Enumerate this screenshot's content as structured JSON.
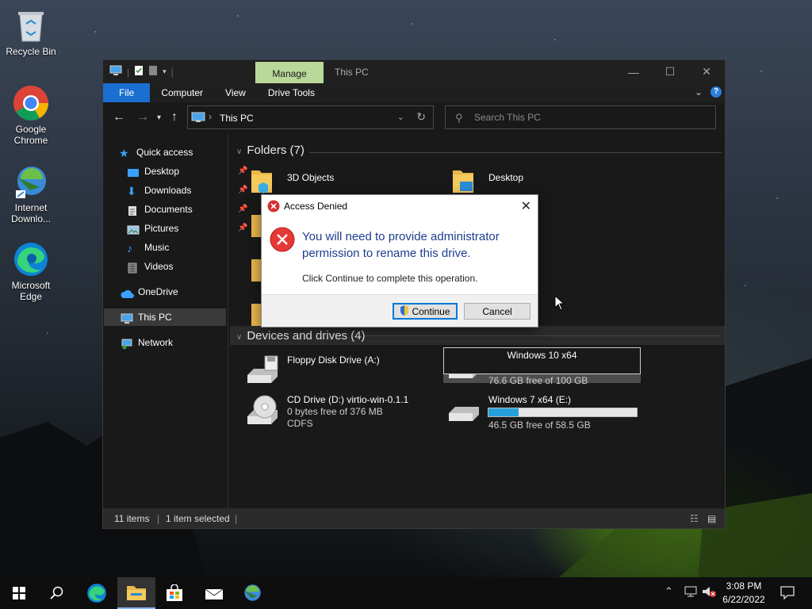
{
  "desktop": {
    "icons": [
      {
        "label": "Recycle Bin"
      },
      {
        "label": "Google Chrome"
      },
      {
        "label": "Internet Downlo..."
      },
      {
        "label": "Microsoft Edge"
      }
    ]
  },
  "explorer": {
    "context_tab": "Manage",
    "title": "This PC",
    "ribbon_tabs": [
      "File",
      "Computer",
      "View",
      "Drive Tools"
    ],
    "address": "This PC",
    "search_placeholder": "Search This PC",
    "nav": {
      "quick_access": "Quick access",
      "items": [
        "Desktop",
        "Downloads",
        "Documents",
        "Pictures",
        "Music",
        "Videos"
      ],
      "onedrive": "OneDrive",
      "this_pc": "This PC",
      "network": "Network"
    },
    "folders_header": "Folders (7)",
    "folders": [
      {
        "name": "3D Objects"
      },
      {
        "name": "Desktop"
      }
    ],
    "devices_header": "Devices and drives (4)",
    "drives": [
      {
        "name": "Floppy Disk Drive (A:)",
        "line2": "",
        "line3": ""
      },
      {
        "name": "Windows 10 x64",
        "line2": "76.6 GB free of 100 GB",
        "used_fraction": 0.234
      },
      {
        "name": "CD Drive (D:) virtio-win-0.1.1",
        "line2": "0 bytes free of 376 MB",
        "line3": "CDFS"
      },
      {
        "name": "Windows 7 x64 (E:)",
        "line2": "46.5 GB free of 58.5 GB",
        "used_fraction": 0.205
      }
    ],
    "status": {
      "items": "11 items",
      "selected": "1 item selected"
    }
  },
  "dialog": {
    "title": "Access Denied",
    "message": "You will need to provide administrator permission to rename this drive.",
    "hint": "Click Continue to complete this operation.",
    "continue_label": "Continue",
    "cancel_label": "Cancel"
  },
  "taskbar": {
    "time": "3:08 PM",
    "date": "6/22/2022"
  },
  "colors": {
    "accent": "#1a6fd0",
    "manage_tab": "#b9d99a",
    "dialog_message": "#1e3d8f",
    "error_red": "#d32f2f",
    "drive_bar": "#26a0da"
  }
}
